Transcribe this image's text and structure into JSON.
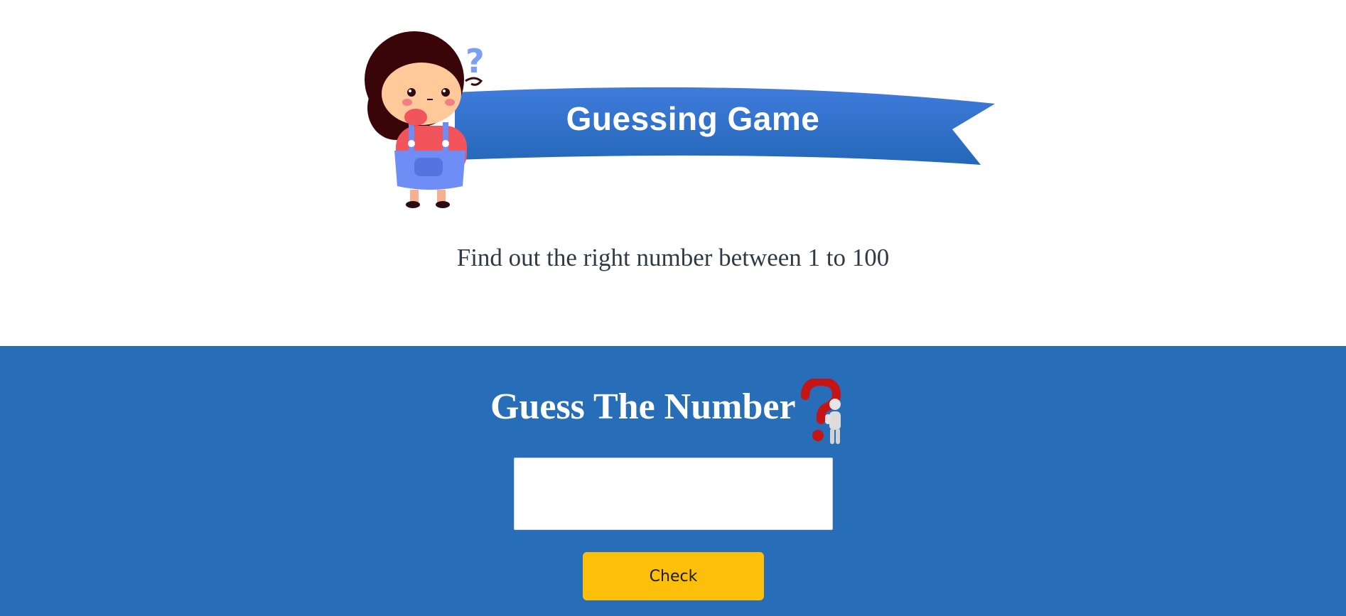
{
  "header": {
    "banner_title": "Guessing Game",
    "subtitle": "Find out the right number between 1 to 100",
    "mascot_icon": "thinking-girl-illustration",
    "banner_color": "#2b6fc0"
  },
  "game": {
    "heading": "Guess The Number",
    "heading_icon": "question-mark-thinker-icon",
    "input": {
      "value": "",
      "placeholder": ""
    },
    "check_label": "Check",
    "panel_color": "#276db7",
    "button_color": "#fcc00a"
  }
}
